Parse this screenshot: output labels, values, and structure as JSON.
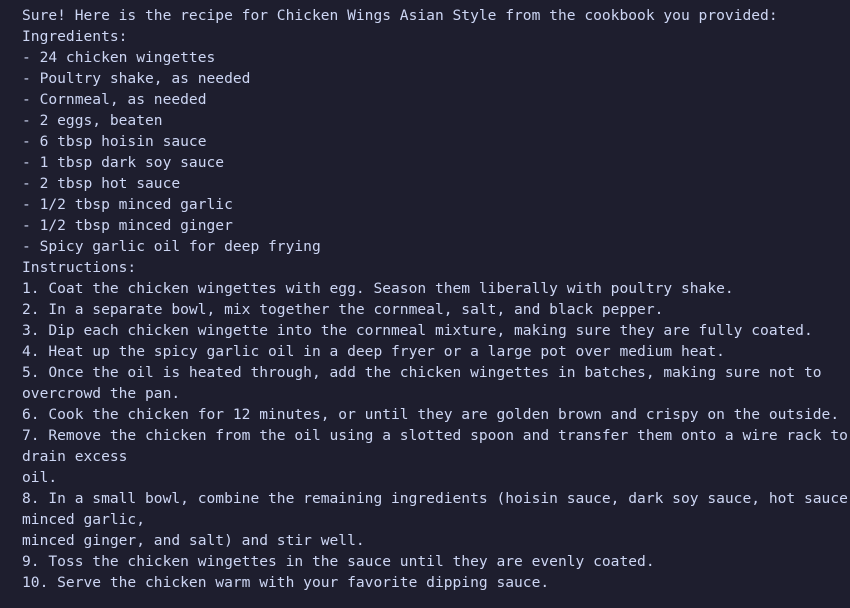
{
  "terminal": {
    "lines": [
      "Sure! Here is the recipe for Chicken Wings Asian Style from the cookbook you provided:",
      "Ingredients:",
      "- 24 chicken wingettes",
      "- Poultry shake, as needed",
      "- Cornmeal, as needed",
      "- 2 eggs, beaten",
      "- 6 tbsp hoisin sauce",
      "- 1 tbsp dark soy sauce",
      "- 2 tbsp hot sauce",
      "- 1/2 tbsp minced garlic",
      "- 1/2 tbsp minced ginger",
      "- Spicy garlic oil for deep frying",
      "Instructions:",
      "1. Coat the chicken wingettes with egg. Season them liberally with poultry shake.",
      "2. In a separate bowl, mix together the cornmeal, salt, and black pepper.",
      "3. Dip each chicken wingette into the cornmeal mixture, making sure they are fully coated.",
      "4. Heat up the spicy garlic oil in a deep fryer or a large pot over medium heat.",
      "5. Once the oil is heated through, add the chicken wingettes in batches, making sure not to",
      "overcrowd the pan.",
      "6. Cook the chicken for 12 minutes, or until they are golden brown and crispy on the outside.",
      "7. Remove the chicken from the oil using a slotted spoon and transfer them onto a wire rack to",
      "drain excess",
      "oil.",
      "8. In a small bowl, combine the remaining ingredients (hoisin sauce, dark soy sauce, hot sauce,",
      "minced garlic,",
      "minced ginger, and salt) and stir well.",
      "9. Toss the chicken wingettes in the sauce until they are evenly coated.",
      "10. Serve the chicken warm with your favorite dipping sauce."
    ]
  }
}
